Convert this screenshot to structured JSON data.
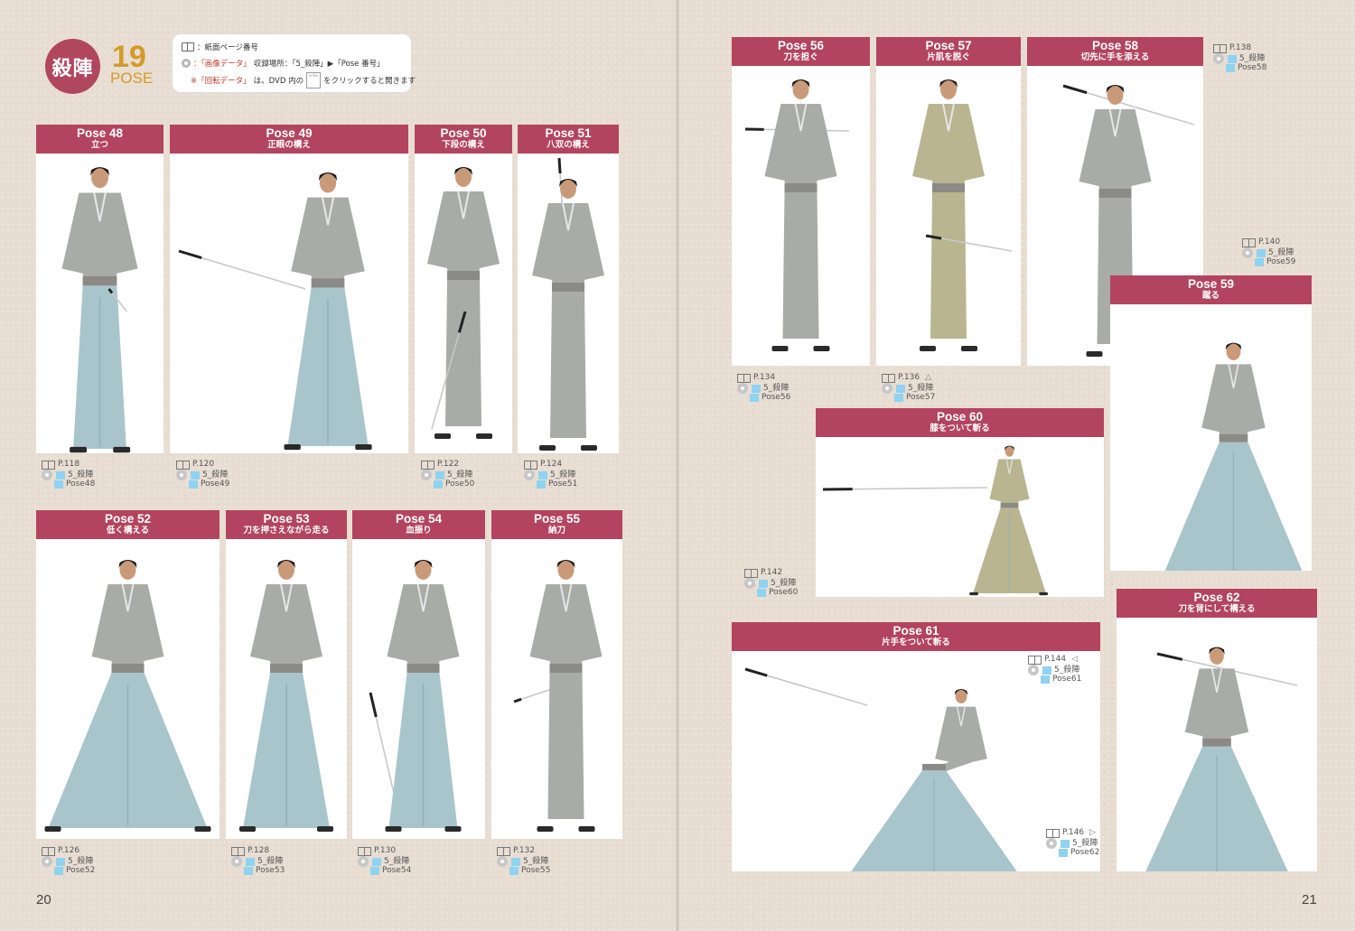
{
  "header": {
    "badge": "殺陣",
    "number": "19",
    "pose_word": "POSE",
    "legend": {
      "line1": "：紙面ページ番号",
      "line2_a": "：「画像データ」",
      "line2_b": "収録場所：「5_殺陣」▶「Pose 番号」",
      "line3_a": "※「回転データ」",
      "line3_b": "は、DVD 内の",
      "line3_c": "をクリックすると開きます",
      "index_icon": "index"
    }
  },
  "poses": [
    {
      "id": "48",
      "title": "Pose 48",
      "subtitle": "立つ",
      "page": "P.118",
      "folder": "5_殺陣",
      "file": "Pose48",
      "arrow": ""
    },
    {
      "id": "49",
      "title": "Pose 49",
      "subtitle": "正眼の構え",
      "page": "P.120",
      "folder": "5_殺陣",
      "file": "Pose49",
      "arrow": ""
    },
    {
      "id": "50",
      "title": "Pose 50",
      "subtitle": "下段の構え",
      "page": "P.122",
      "folder": "5_殺陣",
      "file": "Pose50",
      "arrow": ""
    },
    {
      "id": "51",
      "title": "Pose 51",
      "subtitle": "八双の構え",
      "page": "P.124",
      "folder": "5_殺陣",
      "file": "Pose51",
      "arrow": ""
    },
    {
      "id": "52",
      "title": "Pose 52",
      "subtitle": "低く構える",
      "page": "P.126",
      "folder": "5_殺陣",
      "file": "Pose52",
      "arrow": ""
    },
    {
      "id": "53",
      "title": "Pose 53",
      "subtitle": "刀を押さえながら走る",
      "page": "P.128",
      "folder": "5_殺陣",
      "file": "Pose53",
      "arrow": ""
    },
    {
      "id": "54",
      "title": "Pose 54",
      "subtitle": "血振り",
      "page": "P.130",
      "folder": "5_殺陣",
      "file": "Pose54",
      "arrow": ""
    },
    {
      "id": "55",
      "title": "Pose 55",
      "subtitle": "納刀",
      "page": "P.132",
      "folder": "5_殺陣",
      "file": "Pose55",
      "arrow": ""
    },
    {
      "id": "56",
      "title": "Pose 56",
      "subtitle": "刀を担ぐ",
      "page": "P.134",
      "folder": "5_殺陣",
      "file": "Pose56",
      "arrow": ""
    },
    {
      "id": "57",
      "title": "Pose 57",
      "subtitle": "片肌を脱ぐ",
      "page": "P.136",
      "folder": "5_殺陣",
      "file": "Pose57",
      "arrow": "△"
    },
    {
      "id": "58",
      "title": "Pose 58",
      "subtitle": "切先に手を添える",
      "page": "P.138",
      "folder": "5_殺陣",
      "file": "Pose58",
      "arrow": ""
    },
    {
      "id": "59",
      "title": "Pose 59",
      "subtitle": "蹴る",
      "page": "P.140",
      "folder": "5_殺陣",
      "file": "Pose59",
      "arrow": ""
    },
    {
      "id": "60",
      "title": "Pose 60",
      "subtitle": "膝をついて斬る",
      "page": "P.142",
      "folder": "5_殺陣",
      "file": "Pose60",
      "arrow": ""
    },
    {
      "id": "61",
      "title": "Pose 61",
      "subtitle": "片手をついて斬る",
      "page": "P.144",
      "folder": "5_殺陣",
      "file": "Pose61",
      "arrow": "◁"
    },
    {
      "id": "62",
      "title": "Pose 62",
      "subtitle": "刀を背にして構える",
      "page": "P.146",
      "folder": "5_殺陣",
      "file": "Pose62",
      "arrow": "▷"
    }
  ],
  "pages": {
    "left": "20",
    "right": "21"
  },
  "colors": {
    "header_red": "#b3445f",
    "badge": "#b0475f",
    "accent_gold": "#d49a2a",
    "kimono_gray": "#a9aba6",
    "hakama_blue": "#a9c5cc",
    "kimono_khaki": "#b8b590"
  }
}
